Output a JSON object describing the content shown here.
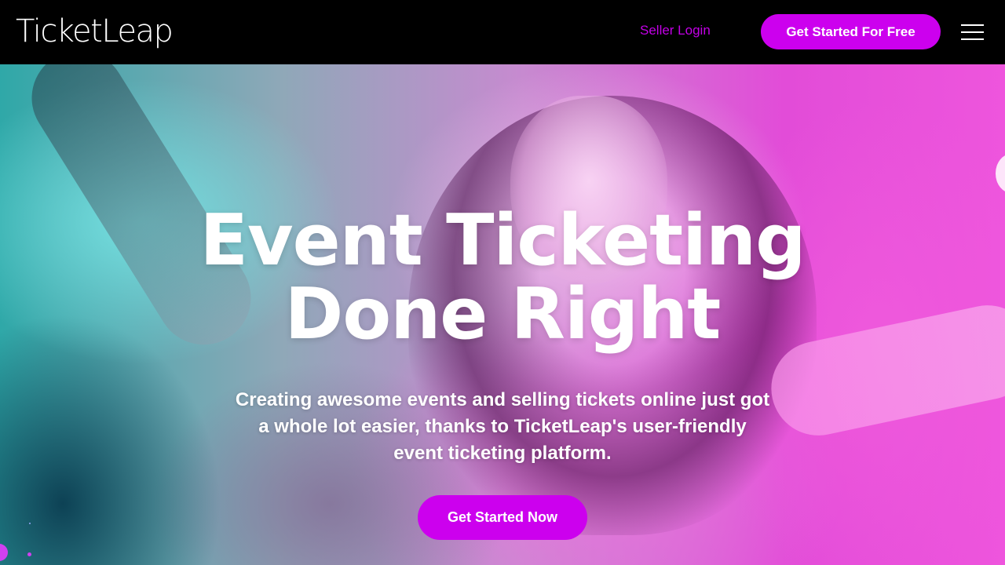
{
  "header": {
    "logo_text": "TicketLeap",
    "seller_login": "Seller Login",
    "cta_label": "Get Started For Free",
    "menu_icon": "hamburger-menu-icon"
  },
  "hero": {
    "title_line1": "Event Ticketing",
    "title_line2": "Done Right",
    "subtitle": "Creating awesome events and selling tickets online just got a whole lot easier, thanks to TicketLeap's user-friendly event ticketing platform.",
    "cta_label": "Get Started Now"
  },
  "colors": {
    "brand": "#cc00ee",
    "link": "#c300e6",
    "header_bg": "#000000",
    "text": "#ffffff"
  }
}
